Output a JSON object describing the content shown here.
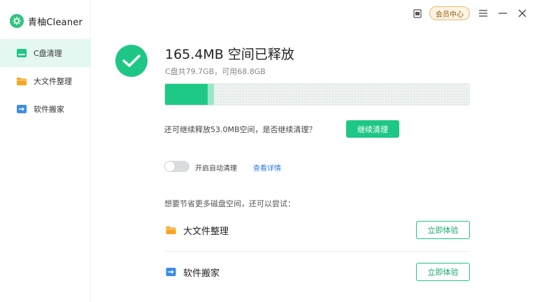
{
  "app": {
    "name": "青柚Cleaner"
  },
  "titlebar": {
    "vip_label": "会员中心"
  },
  "sidebar": {
    "items": [
      {
        "label": "C盘清理",
        "icon": "drive-icon",
        "active": true
      },
      {
        "label": "大文件整理",
        "icon": "folder-icon",
        "active": false
      },
      {
        "label": "软件搬家",
        "icon": "app-move-icon",
        "active": false
      }
    ]
  },
  "result": {
    "title": "165.4MB 空间已释放",
    "subtitle": "C盘共79.7GB，可用68.8GB"
  },
  "disk_bar": {
    "used_fraction": 0.14,
    "freed_fraction": 0.02
  },
  "continue": {
    "text": "还可继续释放53.0MB空间，是否继续清理？",
    "button_label": "继续清理"
  },
  "auto_clean": {
    "label": "开启自动清理",
    "enabled": false,
    "detail_link": "查看详情"
  },
  "suggestions": {
    "title": "想要节省更多磁盘空间，还可以尝试：",
    "items": [
      {
        "label": "大文件整理",
        "button_label": "立即体验",
        "icon": "folder-icon"
      },
      {
        "label": "软件搬家",
        "button_label": "立即体验",
        "icon": "app-move-icon"
      }
    ]
  },
  "colors": {
    "accent": "#1fc786",
    "link": "#2d7be5",
    "folder": "#f5a623",
    "app_icon": "#3a8ee6"
  }
}
